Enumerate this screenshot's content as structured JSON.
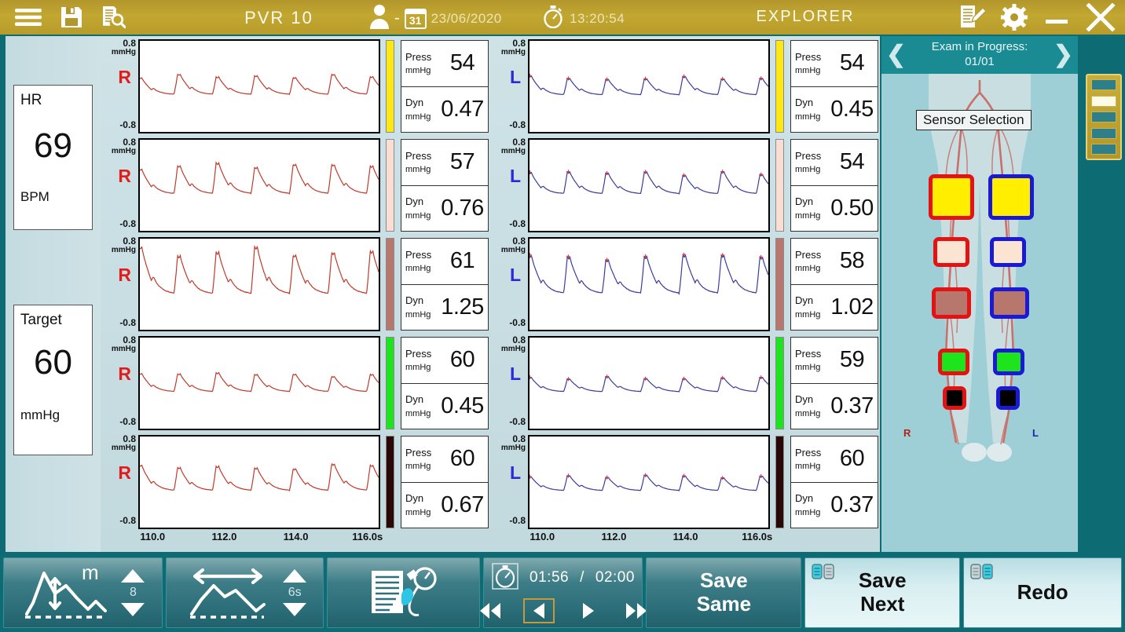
{
  "topbar": {
    "menu_icon": "hamburger-menu-icon",
    "save_icon": "floppy-save-icon",
    "review_icon": "document-search-icon",
    "title": "PVR 10",
    "patient_icon": "user-icon",
    "patient_name": "-",
    "calendar_day": "31",
    "date": "23/06/2020",
    "clock_icon": "stopwatch-icon",
    "time": "13:20:54",
    "mode": "EXPLORER",
    "notes_icon": "notes-edit-icon",
    "settings_icon": "gear-icon",
    "minimize_label": "minimize",
    "close_label": "close",
    "bg_color": "#c2a731"
  },
  "vitals": {
    "hr": {
      "label": "HR",
      "value": "69",
      "unit": "BPM"
    },
    "target": {
      "label": "Target",
      "value": "60",
      "unit": "mmHg"
    }
  },
  "waveforms": {
    "y_top": "0.8",
    "y_unit": "mmHg",
    "y_bottom": "-0.8",
    "x_ticks": [
      "110.0",
      "112.0",
      "114.0",
      "116.0s"
    ],
    "x_range": [
      109.6,
      116.4
    ],
    "press_label": "Press",
    "dyn_label": "Dyn",
    "unit": "mmHg",
    "right_label": "R",
    "left_label": "L",
    "right_color": "#c0392b",
    "left_color": "#3b3b9e",
    "rows": [
      {
        "bar_color": "#ffe714",
        "right": {
          "side": "R",
          "press": "54",
          "dyn": "0.47",
          "amp": 0.4,
          "beats": 6.2,
          "base": 0.06
        },
        "left": {
          "side": "L",
          "press": "54",
          "dyn": "0.45",
          "amp": 0.38,
          "beats": 6.2,
          "base": 0.05
        }
      },
      {
        "bar_color": "#fbded3",
        "right": {
          "side": "R",
          "press": "57",
          "dyn": "0.76",
          "amp": 0.62,
          "beats": 6.2,
          "base": 0.05
        },
        "left": {
          "side": "L",
          "press": "54",
          "dyn": "0.50",
          "amp": 0.44,
          "beats": 6.2,
          "base": 0.05
        }
      },
      {
        "bar_color": "#b7776c",
        "right": {
          "side": "R",
          "press": "61",
          "dyn": "1.25",
          "amp": 0.95,
          "beats": 6.2,
          "base": 0.02
        },
        "left": {
          "side": "L",
          "press": "58",
          "dyn": "1.02",
          "amp": 0.82,
          "beats": 6.2,
          "base": 0.03
        }
      },
      {
        "bar_color": "#1ee41e",
        "right": {
          "side": "R",
          "press": "60",
          "dyn": "0.45",
          "amp": 0.38,
          "beats": 6.2,
          "base": 0.05
        },
        "left": {
          "side": "L",
          "press": "59",
          "dyn": "0.37",
          "amp": 0.32,
          "beats": 6.2,
          "base": 0.05
        }
      },
      {
        "bar_color": "#2b0808",
        "right": {
          "side": "R",
          "press": "60",
          "dyn": "0.67",
          "amp": 0.55,
          "beats": 6.2,
          "base": 0.05
        },
        "left": {
          "side": "L",
          "press": "60",
          "dyn": "0.37",
          "amp": 0.32,
          "beats": 6.2,
          "base": 0.05
        }
      }
    ]
  },
  "sensor_panel": {
    "exam_status": "Exam in Progress:",
    "exam_count": "01/01",
    "prev_icon": "chevron-left-icon",
    "next_icon": "chevron-right-icon",
    "tooltip": "Sensor Selection",
    "right_leg_label": "R",
    "left_leg_label": "L",
    "cuffs": [
      {
        "level": "thigh",
        "fill": "#ffee00",
        "right_border": "#e41313",
        "left_border": "#1a1ad4"
      },
      {
        "level": "calf",
        "fill": "#fbe4d2",
        "right_border": "#e41313",
        "left_border": "#1a1ad4"
      },
      {
        "level": "ankle",
        "fill": "#b7776c",
        "right_border": "#e41313",
        "left_border": "#1a1ad4"
      },
      {
        "level": "metatarsal",
        "fill": "#1ee41e",
        "right_border": "#e41313",
        "left_border": "#1a1ad4"
      },
      {
        "level": "toe",
        "fill": "#000000",
        "right_border": "#e41313",
        "left_border": "#1a1ad4"
      }
    ]
  },
  "segment_list": {
    "icon": "segment-list-icon",
    "segments": 5,
    "selected_index": 1
  },
  "bottombar": {
    "amplitude": {
      "icon": "amplitude-scale-icon",
      "value": "8",
      "up_icon": "triangle-up-icon",
      "down_icon": "triangle-down-icon"
    },
    "timebase": {
      "icon": "timebase-width-icon",
      "value": "6s",
      "up_icon": "triangle-up-icon",
      "down_icon": "triangle-down-icon"
    },
    "report": {
      "icon": "report-pressure-icon"
    },
    "playback": {
      "timer_icon": "stopwatch-icon",
      "elapsed": "01:56",
      "separator": "/",
      "total": "02:00",
      "rewind_icon": "rewind-icon",
      "step_back_icon": "step-back-icon",
      "play_icon": "play-icon",
      "fast_forward_icon": "fast-forward-icon",
      "selected_control": "step-back"
    },
    "save_same": {
      "label_line1": "Save",
      "label_line2": "Same"
    },
    "save_next": {
      "icon": "sensor-pair-icon",
      "label_line1": "Save",
      "label_line2": "Next"
    },
    "redo": {
      "icon": "sensor-pair-icon",
      "label": "Redo"
    }
  }
}
